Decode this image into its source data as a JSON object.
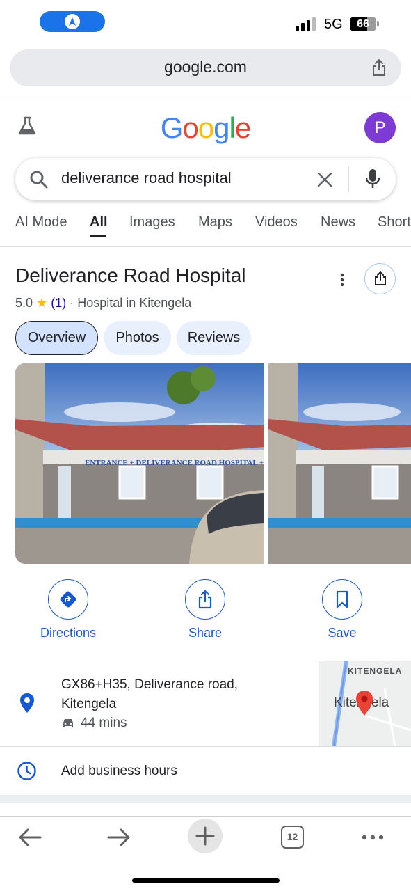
{
  "status_bar": {
    "network": "5G",
    "battery": "66",
    "battery_level": 0.66
  },
  "browser": {
    "url": "google.com",
    "tab_count": "12"
  },
  "google": {
    "logo_text": "Google",
    "avatar_letter": "P"
  },
  "search": {
    "query": "deliverance road hospital"
  },
  "tabs": [
    {
      "label": "AI Mode"
    },
    {
      "label": "All"
    },
    {
      "label": "Images"
    },
    {
      "label": "Maps"
    },
    {
      "label": "Videos"
    },
    {
      "label": "News"
    },
    {
      "label": "Short"
    }
  ],
  "place": {
    "name": "Deliverance Road Hospital",
    "rating": "5.0",
    "star": "★",
    "review_count": "(1)",
    "category": "· Hospital in Kitengela",
    "chips": [
      {
        "label": "Overview"
      },
      {
        "label": "Photos"
      },
      {
        "label": "Reviews"
      }
    ],
    "photo_sign": "ENTRANCE + DELIVERANCE ROAD HOSPITAL +",
    "actions": [
      {
        "label": "Directions"
      },
      {
        "label": "Share"
      },
      {
        "label": "Save"
      }
    ],
    "address_line1": "GX86+H35, Deliverance road,",
    "address_line2": "Kitengela",
    "drive_time": "44 mins",
    "map_label_top": "KITENGELA",
    "map_label_main": "Kitengela",
    "hours_text": "Add business hours"
  },
  "colors": {
    "accent_blue": "#1558d6",
    "avatar_purple": "#7e3bd3",
    "star_yellow": "#fbbc04",
    "map_pin_red": "#ea4335"
  }
}
